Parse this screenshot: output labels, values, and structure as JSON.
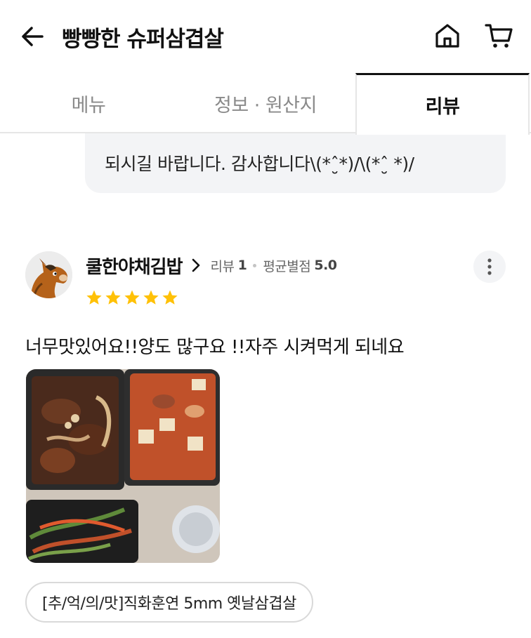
{
  "header": {
    "title": "빵빵한 슈퍼삼겹살",
    "back_icon": "arrow-left-icon",
    "home_icon": "home-icon",
    "cart_icon": "cart-icon"
  },
  "tabs": [
    {
      "label": "메뉴",
      "active": false
    },
    {
      "label": "정보 · 원산지",
      "active": false
    },
    {
      "label": "리뷰",
      "active": true
    }
  ],
  "owner_reply": {
    "visible_text": "되시길 바랍니다. 감사합니다\\(*ˆ̮*)/\\(*ˆ̮ *)/"
  },
  "review": {
    "reviewer_name": "쿨한야채김밥",
    "review_count_label": "리뷰",
    "review_count": "1",
    "avg_rating_label": "평균별점",
    "avg_rating": "5.0",
    "stars": 5,
    "text": "너무맛있어요!!양도 많구요 !!자주 시켜먹게 되네요",
    "menu_tag": "[추/억/의/맛]직화훈연 5mm 옛날삼겹살",
    "more_icon": "more-vertical-icon",
    "star_color": "#FFC107"
  }
}
